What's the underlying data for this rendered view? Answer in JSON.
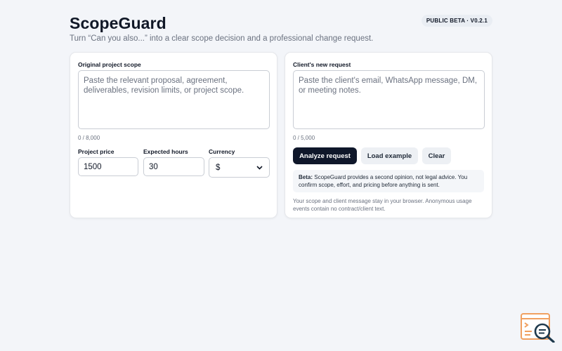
{
  "app": {
    "title": "ScopeGuard",
    "tagline": "Turn “Can you also...” into a clear scope decision and a professional change request.",
    "badge": "PUBLIC BETA · V0.2.1"
  },
  "left_card": {
    "scope_label": "Original project scope",
    "scope_placeholder": "Paste the relevant proposal, agreement, deliverables, revision limits, or project scope.",
    "scope_value": "",
    "scope_counter": "0 / 8,000",
    "price_label": "Project price",
    "price_value": "1500",
    "hours_label": "Expected hours",
    "hours_value": "30",
    "currency_label": "Currency",
    "currency_value": "$"
  },
  "right_card": {
    "request_label": "Client's new request",
    "request_placeholder": "Paste the client's email, WhatsApp message, DM, or meeting notes.",
    "request_value": "",
    "request_counter": "0 / 5,000",
    "analyze_button": "Analyze request",
    "example_button": "Load example",
    "clear_button": "Clear",
    "beta_prefix": "Beta:",
    "beta_text": " ScopeGuard provides a second opinion, not legal advice. You confirm scope, effort, and pricing before anything is sent.",
    "privacy_text": "Your scope and client message stay in your browser. Anonymous usage events contain no contract/client text."
  },
  "icons": {
    "chevron": "chevron-down-icon",
    "logo": "scope-search-logo-icon"
  },
  "colors": {
    "background": "#f3f5f9",
    "primary_button": "#0f172a",
    "logo_orange": "#f0a060",
    "logo_dark": "#1f3a4d"
  }
}
